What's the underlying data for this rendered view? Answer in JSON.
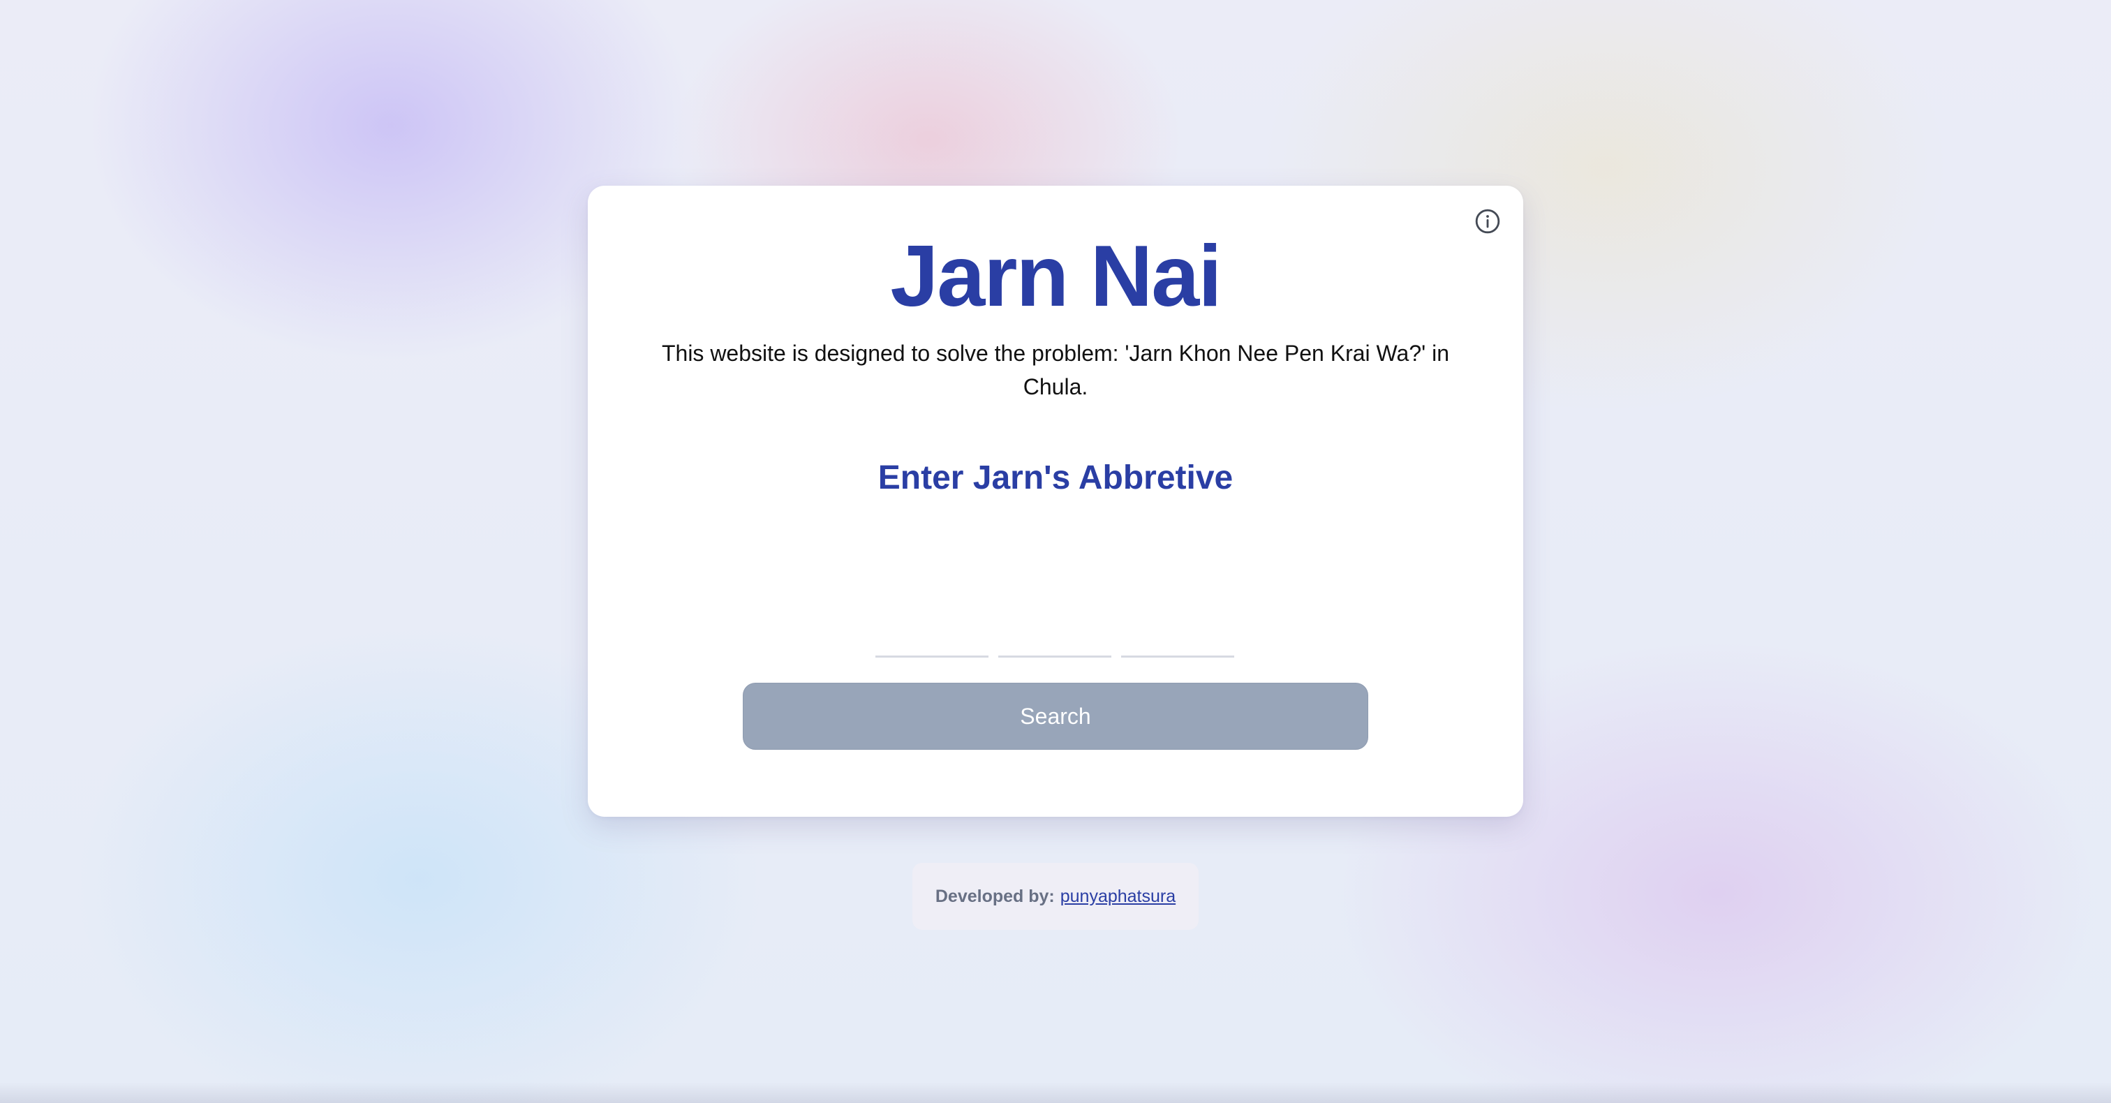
{
  "card": {
    "title": "Jarn Nai",
    "description": "This website is designed to solve the problem: 'Jarn Khon Nee Pen Krai Wa?' in Chula.",
    "subtitle": "Enter Jarn's Abbretive",
    "inputs": [
      {
        "value": "",
        "placeholder": ""
      },
      {
        "value": "",
        "placeholder": ""
      },
      {
        "value": "",
        "placeholder": ""
      }
    ],
    "search_label": "Search",
    "info_icon": "info-circle-icon"
  },
  "footer": {
    "label": "Developed by:",
    "link_text": "punyaphatsura"
  },
  "colors": {
    "accent": "#2a3ea4",
    "button_disabled": "#98a5b9",
    "card": "#ffffff"
  }
}
